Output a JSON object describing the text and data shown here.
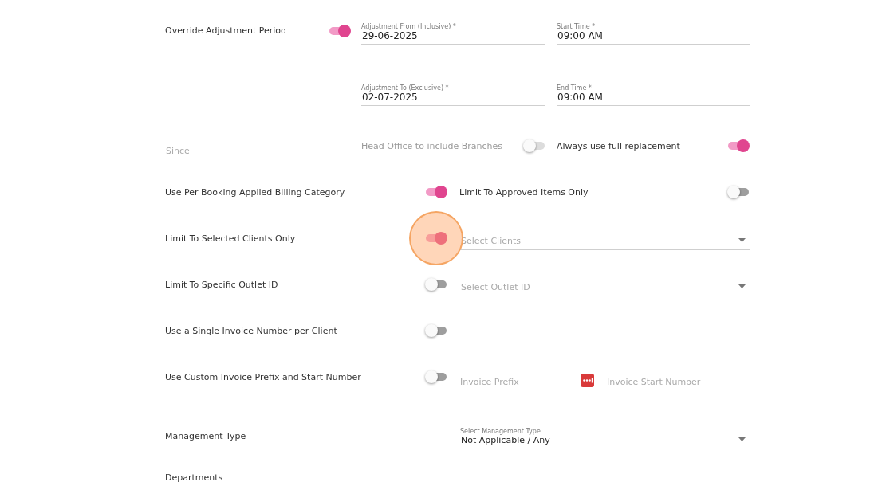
{
  "rows": [
    {
      "kind": "toggle_fields",
      "label": "Override Adjustment Period",
      "on": true,
      "fields": [
        {
          "label": "Adjustment From (Inclusive) *",
          "value": "29-06-2025"
        },
        {
          "label": "Start Time *",
          "value": "09:00 AM"
        }
      ]
    },
    {
      "kind": "fields",
      "fields": [
        {
          "label": "Adjustment To (Exclusive) *",
          "value": "02-07-2025"
        },
        {
          "label": "End Time *",
          "value": "09:00 AM"
        }
      ]
    },
    {
      "kind": "since",
      "field": {
        "placeholder": "Since",
        "disabled": true
      },
      "toggles": [
        {
          "label": "Head Office to include Branches",
          "on": false,
          "disabled": true
        },
        {
          "label": "Always use full replacement",
          "on": true,
          "disabled": false
        }
      ]
    },
    {
      "kind": "dual_toggle",
      "label": "Use Per Booking Applied Billing Category",
      "on": true,
      "second": {
        "label": "Limit To Approved Items Only",
        "on": false
      }
    },
    {
      "kind": "toggle_select",
      "label": "Limit To Selected Clients Only",
      "on": true,
      "clicked": true,
      "select": {
        "placeholder": "Select Clients",
        "disabled": false
      }
    },
    {
      "kind": "toggle_select",
      "label": "Limit To Specific Outlet ID",
      "on": false,
      "clicked": false,
      "select": {
        "placeholder": "Select Outlet ID",
        "disabled": true
      }
    },
    {
      "kind": "toggle",
      "label": "Use a Single Invoice Number per Client",
      "on": false
    },
    {
      "kind": "toggle_inputs",
      "label": "Use Custom Invoice Prefix and Start Number",
      "on": false,
      "inputs": [
        {
          "placeholder": "Invoice Prefix",
          "disabled": true,
          "icon": true
        },
        {
          "placeholder": "Invoice Start Number",
          "disabled": true,
          "icon": false
        }
      ]
    },
    {
      "kind": "labeled_select",
      "label": "Management Type",
      "select": {
        "label": "Select Management Type",
        "value": "Not Applicable / Any"
      }
    },
    {
      "kind": "labeled_select",
      "label": "Departments"
    }
  ]
}
